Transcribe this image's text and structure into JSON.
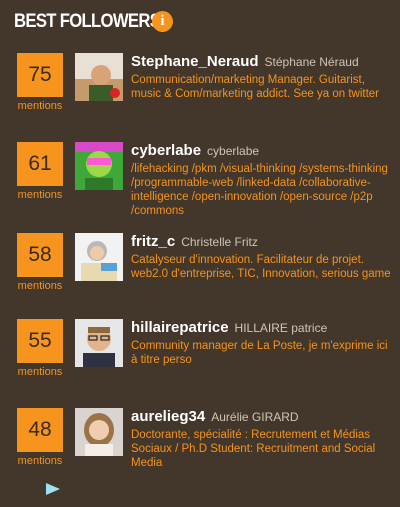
{
  "header": {
    "title": "BEST FOLLOWERS",
    "info_icon": "info-icon"
  },
  "colors": {
    "background": "#43362a",
    "accent": "#f7941d",
    "username": "#ffffff",
    "realname": "#cfc6b6"
  },
  "followers": [
    {
      "count": "75",
      "count_label": "mentions",
      "username": "Stephane_Neraud",
      "realname": "Stéphane Néraud",
      "bio": "Communication/marketing Manager. Guitarist, music & Com/marketing addict. See ya on twitter"
    },
    {
      "count": "61",
      "count_label": "mentions",
      "username": "cyberlabe",
      "realname": "cyberlabe",
      "bio": "/lifehacking /pkm /visual-thinking /systems-thinking /programmable-web /linked-data /collaborative-intelligence /open-innovation /open-source /p2p /commons"
    },
    {
      "count": "58",
      "count_label": "mentions",
      "username": "fritz_c",
      "realname": "Christelle Fritz",
      "bio": "Catalyseur d'innovation. Facilitateur de projet. web2.0 d'entreprise, TIC, Innovation, serious game"
    },
    {
      "count": "55",
      "count_label": "mentions",
      "username": "hillairepatrice",
      "realname": "HILLAIRE patrice",
      "bio": "Community manager de La Poste, je m'exprime ici à titre perso"
    },
    {
      "count": "48",
      "count_label": "mentions",
      "username": "aurelieg34",
      "realname": "Aurélie GIRARD",
      "bio": "Doctorante, spécialité : Recrutement et Médias Sociaux / Ph.D Student: Recruitment and Social Media"
    }
  ],
  "footer": {
    "more_icon": "play-arrow-icon"
  }
}
